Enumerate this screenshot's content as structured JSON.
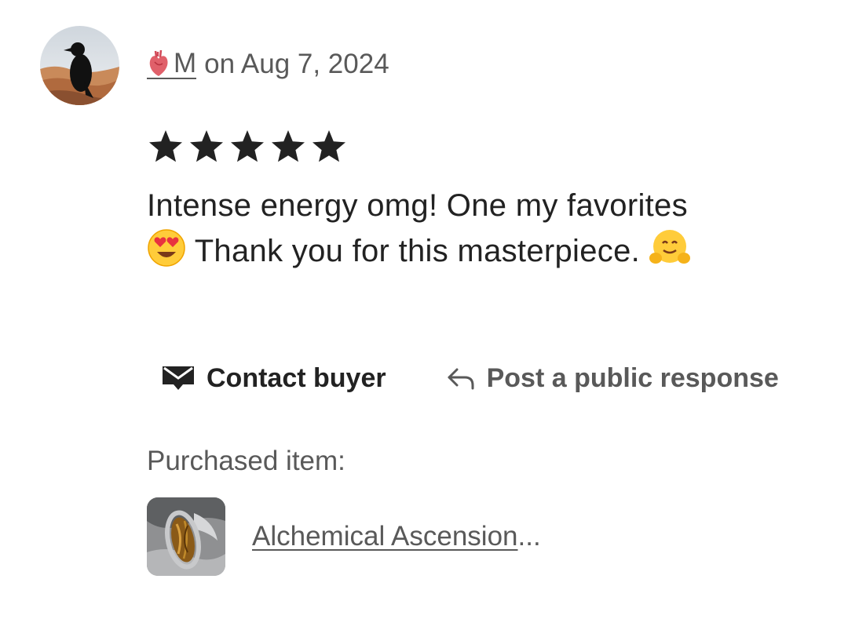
{
  "review": {
    "reviewer_name": "M",
    "date_text": "on Aug 7, 2024",
    "rating": 5,
    "rating_max": 5,
    "text_line1": "Intense energy omg! One my favorites",
    "text_line2": "Thank you for this masterpiece.",
    "icons": {
      "reviewer_badge": "anatomical-heart-icon",
      "avatar": "raven-avatar",
      "emoji_1": "heart-eyes-emoji",
      "emoji_2": "hugging-face-emoji"
    }
  },
  "actions": {
    "contact_label": "Contact buyer",
    "contact_icon": "envelope-icon",
    "respond_label": "Post a public response",
    "respond_icon": "reply-arrow-icon"
  },
  "purchase": {
    "label": "Purchased item:",
    "item_title": "Alchemical Ascension",
    "item_ellipsis": "..."
  },
  "colors": {
    "text_primary": "#222222",
    "text_secondary": "#595959",
    "star": "#222222"
  }
}
